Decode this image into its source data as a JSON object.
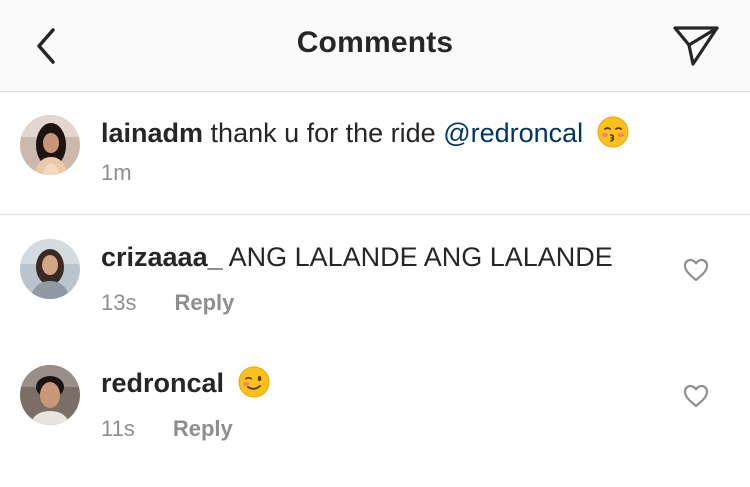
{
  "header": {
    "title": "Comments",
    "back_icon": "chevron-left-icon",
    "share_icon": "paper-plane-icon"
  },
  "caption": {
    "username": "lainadm",
    "text": "thank u for the ride",
    "mention": "@redroncal",
    "emoji": "kissing-face-with-closed-eyes",
    "time": "1m"
  },
  "comments": [
    {
      "username": "crizaaaa_",
      "text": "ANG LALANDE ANG LALANDE",
      "time": "13s",
      "reply_label": "Reply"
    },
    {
      "username": "redroncal",
      "text": "",
      "emoji": "winking-face",
      "time": "11s",
      "reply_label": "Reply"
    }
  ],
  "colors": {
    "text": "#262626",
    "secondary": "#8e8e8e",
    "mention": "#003569",
    "header_bg": "#fafafa"
  }
}
